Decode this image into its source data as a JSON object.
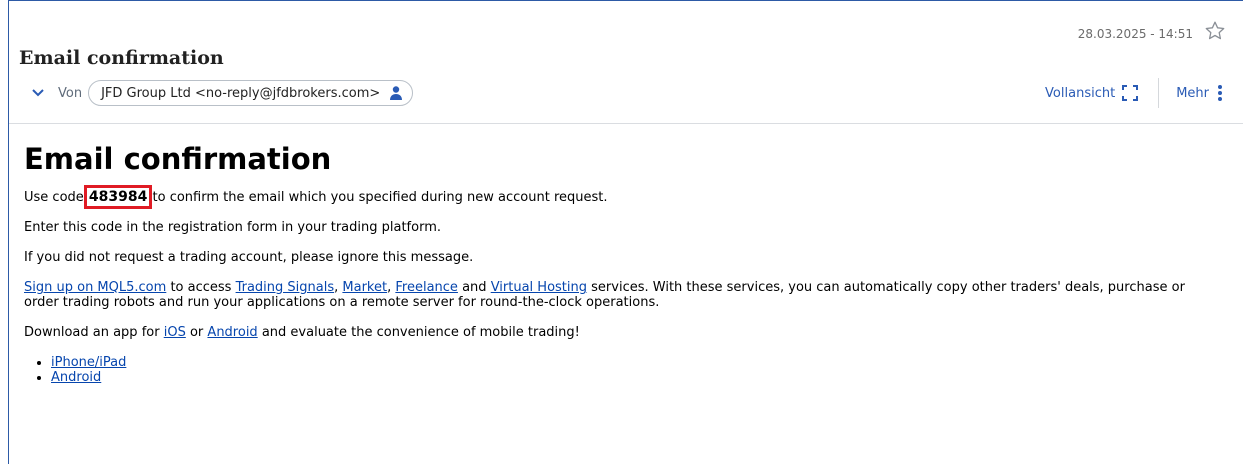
{
  "header": {
    "date": "28.03.2025 - 14:51",
    "subject": "Email confirmation",
    "from_label": "Von",
    "sender": "JFD Group Ltd <no-reply@jfdbrokers.com>",
    "fullview_label": "Vollansicht",
    "more_label": "Mehr"
  },
  "body": {
    "heading": "Email confirmation",
    "p1_before": "Use code",
    "code": "483984",
    "p1_after": "to confirm the email which you specified during new account request.",
    "p2": "Enter this code in the registration form in your trading platform.",
    "p3": "If you did not request a trading account, please ignore this message.",
    "p4_link1": "Sign up on MQL5.com",
    "p4_t1": "to access",
    "p4_link2": "Trading Signals",
    "p4_t2": ",",
    "p4_link3": "Market",
    "p4_t3": ",",
    "p4_link4": "Freelance",
    "p4_t4": "and",
    "p4_link5": "Virtual Hosting",
    "p4_t5": "services. With these services, you can automatically copy other traders' deals, purchase or order trading robots and run your applications on a remote server for round-the-clock operations.",
    "p5_t1": "Download an app for",
    "p5_link1": "iOS",
    "p5_t2": "or",
    "p5_link2": "Android",
    "p5_t3": "and evaluate the convenience of mobile trading!",
    "list": [
      "iPhone/iPad",
      "Android"
    ]
  },
  "icons": {
    "star": "star-outline-icon",
    "chevron": "chevron-down-icon",
    "person": "person-icon",
    "fullview": "fullscreen-icon",
    "more": "more-vertical-icon"
  },
  "colors": {
    "accent": "#2a5bb5",
    "link": "#0645ad",
    "highlight": "#e01b24",
    "frame": "#2d5aa6"
  }
}
